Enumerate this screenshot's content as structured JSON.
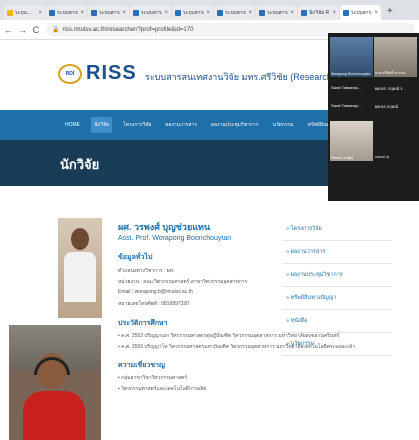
{
  "browser": {
    "tabs": [
      {
        "label": "ระบบ...",
        "active": false,
        "color": "#f4b400"
      },
      {
        "label": "ระบบสารสน",
        "active": false,
        "color": "#2a6fb7"
      },
      {
        "label": "ระบบสารสน",
        "active": false,
        "color": "#2a6fb7"
      },
      {
        "label": "ระบบสารสน",
        "active": false,
        "color": "#2a6fb7"
      },
      {
        "label": "ระบบสารสน",
        "active": false,
        "color": "#2a6fb7"
      },
      {
        "label": "ระบบสารสน",
        "active": false,
        "color": "#2a6fb7"
      },
      {
        "label": "ระบบสารสน",
        "active": false,
        "color": "#2a6fb7"
      },
      {
        "label": "นักวิจัย R",
        "active": false,
        "color": "#2a6fb7"
      },
      {
        "label": "ระบบสาร",
        "active": true,
        "color": "#2a6fb7"
      }
    ],
    "new_tab": "+",
    "url": "riss.rmutsv.ac.th/researcher/?prof=profile&id=170"
  },
  "site": {
    "logo_badge": "RDI",
    "logo_text": "RISS",
    "subtitle": "ระบบสารสนเทศงานวิจัย มทร.ศรีวิชัย (Research Information",
    "nav": [
      {
        "label": "HOME",
        "active": false
      },
      {
        "label": "นักวิจัย",
        "active": true
      },
      {
        "label": "โครงการวิจัย",
        "active": false
      },
      {
        "label": "ผลงานวารสาร",
        "active": false
      },
      {
        "label": "ผลงานประชุมวิชาการ",
        "active": false
      },
      {
        "label": "นวัตกรรม",
        "active": false
      },
      {
        "label": "ทรัพย์สินทางปัญญา",
        "active": false
      },
      {
        "label": "หนังสือ",
        "active": false
      }
    ],
    "page_title": "นักวิจัย"
  },
  "profile": {
    "name_th": "ผศ. วรพงศ์ บุญช่วยแทน",
    "name_en": "Asst. Prof. Worapong Boonchouytan",
    "general_heading": "ข้อมูลทั่วไป",
    "general_lines": [
      "ตำแหน่งทางวิชาการ : ผศ.",
      "หน่วยงาน : คณะวิศวกรรมศาสตร์ สาขาวิศวกรรมอุตสาหการ",
      "Email : worapong.b@rmutsv.ac.th",
      "หมายเลขโทรศัพท์ : 0816897320"
    ],
    "education_heading": "ประวัติการศึกษา",
    "education_lines": [
      "• ค.ศ. 2553 ปริญญาเอก วิศวกรรมศาสตรดุษฎีบัณฑิต วิศวกรรมอุตสาหการ มหาวิทยาลัยสงขลานครินทร์",
      "• ค.ศ. 2553 ปริญญาโท วิศวกรรมศาสตรมหาบัณฑิต วิศวกรรมอุตสาหการ มหาวิทยาลัยเทคโนโลยีพระจอมเกล้า"
    ],
    "expertise_heading": "ความเชี่ยวชาญ",
    "expertise_lines": [
      "• กลุ่มสาขาวิชาวิศวกรรมศาสตร์",
      "• วิศวกรรมศาสตร์และเทคโนโลยีการผลิต"
    ]
  },
  "side_links": [
    "» โครงการวิจัย",
    "» ผลงานวารสาร",
    "» ผลงานประชุมวิชาการ",
    "» ทรัพย์สินทางปัญญา",
    "» หนังสือ",
    "» นวัตกรรม"
  ],
  "video_call": {
    "participants": [
      {
        "name": "Worapong Boonchouytan"
      },
      {
        "name": "นาย ทวีศักดิ์ สุวรรณ"
      },
      {
        "name": "Sarat Tatsanap..."
      },
      {
        "name": "ผศ.ดร. กฤษณ์ ร..."
      },
      {
        "name": "Sarat Tatsanap..."
      },
      {
        "name": "ผศ.ดร.กฤษณ์"
      },
      {
        "name": "Rawat Lungky"
      },
      {
        "name": "กฤษณ์ รุ่ง"
      }
    ]
  }
}
